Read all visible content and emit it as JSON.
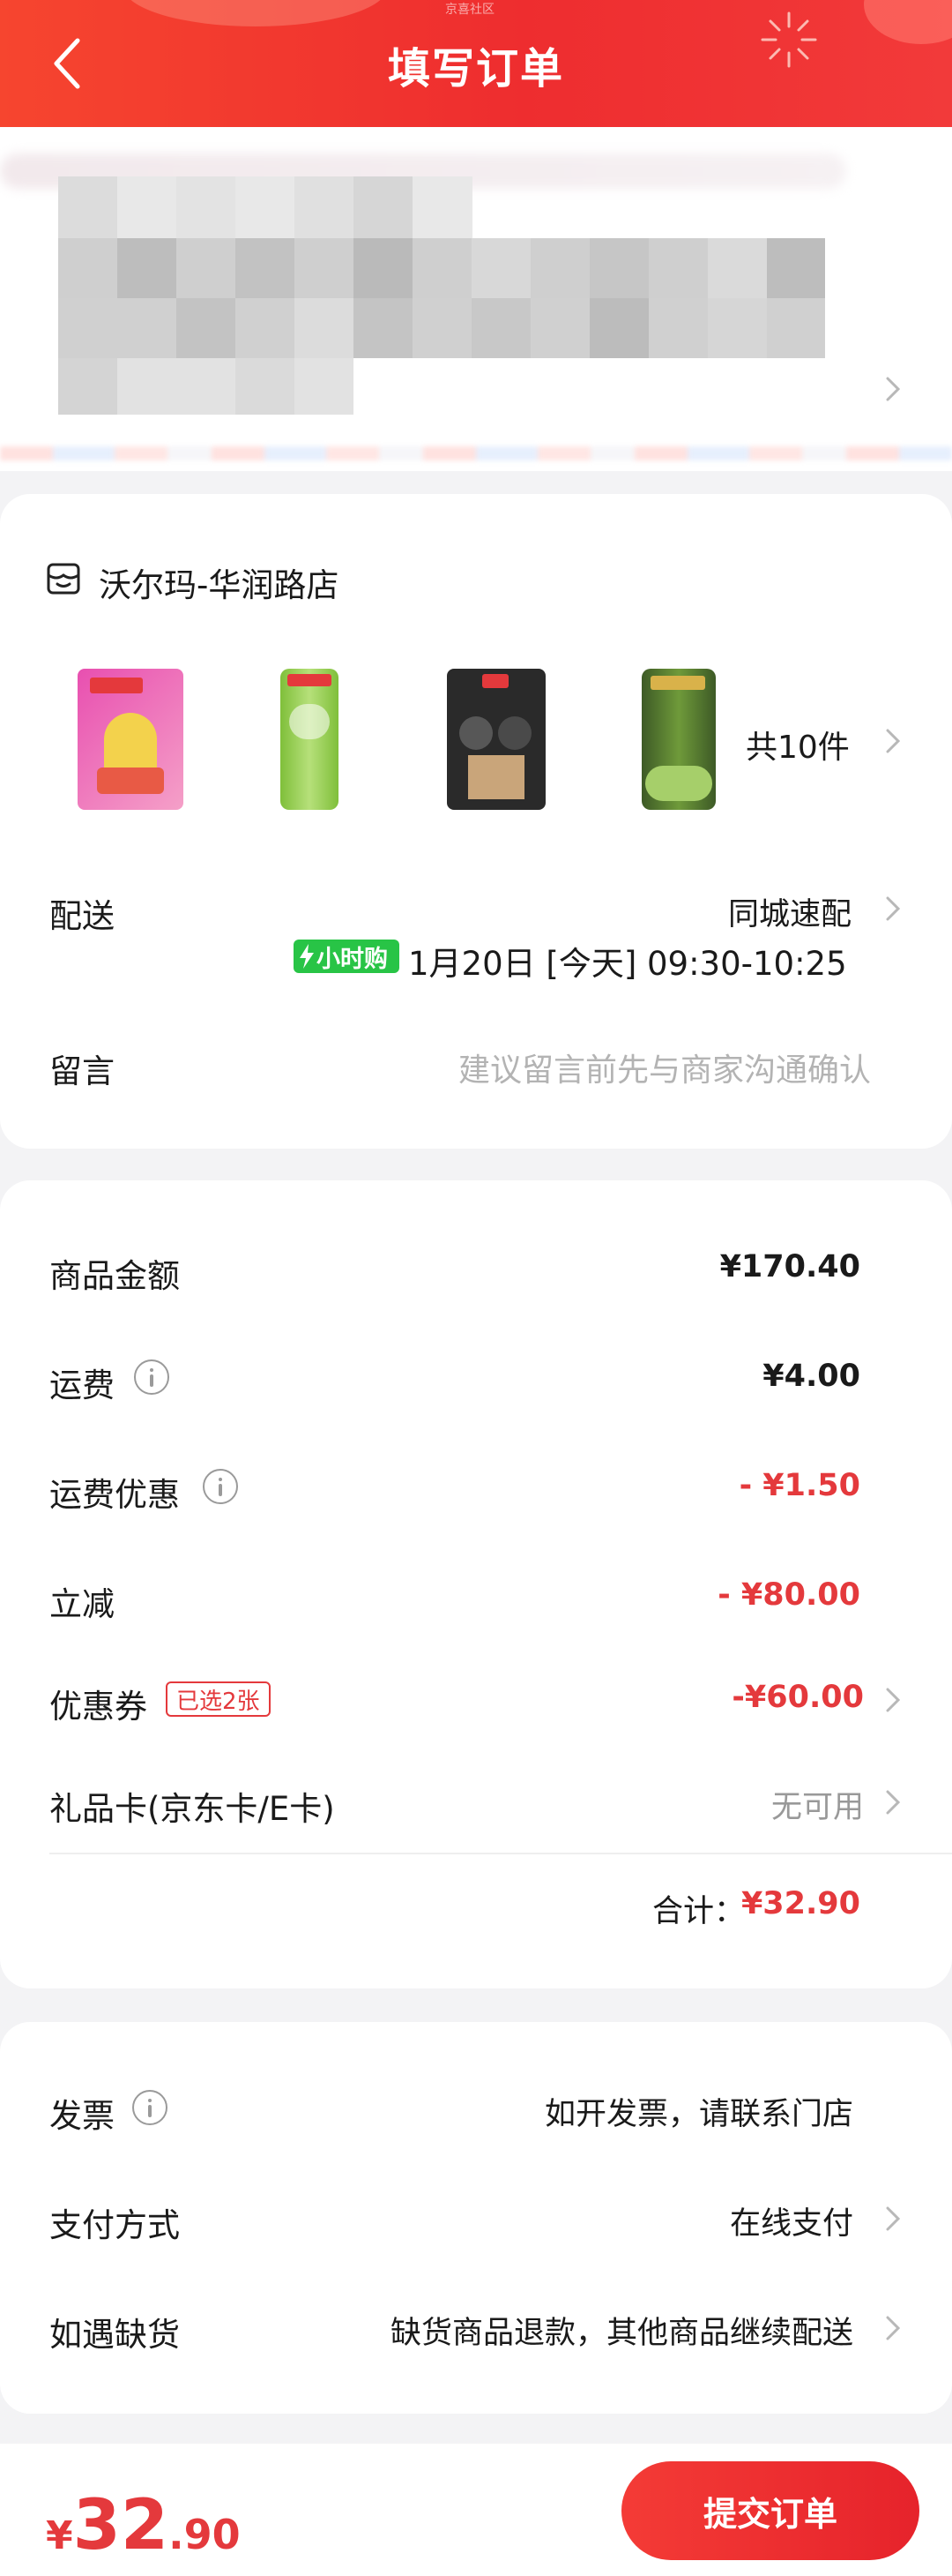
{
  "header": {
    "title": "填写订单",
    "sub_text": "京喜社区"
  },
  "store": {
    "name": "沃尔玛-华润路店",
    "item_count": "共10件"
  },
  "delivery": {
    "label": "配送",
    "method": "同城速配",
    "badge": "小时购",
    "time": "1月20日 [今天] 09:30-10:25"
  },
  "message": {
    "label": "留言",
    "placeholder": "建议留言前先与商家沟通确认"
  },
  "pricing": {
    "goods_label": "商品金额",
    "goods_value": "¥170.40",
    "shipping_label": "运费",
    "shipping_value": "¥4.00",
    "shipping_discount_label": "运费优惠",
    "shipping_discount_value": "- ¥1.50",
    "instant_off_label": "立减",
    "instant_off_value": "- ¥80.00",
    "coupon_label": "优惠券",
    "coupon_tag": "已选2张",
    "coupon_value": "-¥60.00",
    "giftcard_label": "礼品卡(京东卡/E卡)",
    "giftcard_value": "无可用",
    "total_label": "合计：",
    "total_value": "¥32.90"
  },
  "other": {
    "invoice_label": "发票",
    "invoice_value": "如开发票，请联系门店",
    "payment_label": "支付方式",
    "payment_value": "在线支付",
    "stockout_label": "如遇缺货",
    "stockout_value": "缺货商品退款，其他商品继续配送"
  },
  "footer": {
    "currency": "¥",
    "amount_int": "32",
    "amount_dec": ".90",
    "submit_label": "提交订单"
  },
  "colors": {
    "accent": "#e4393c",
    "header_bg": "#f23a33",
    "badge_green": "#28c446"
  }
}
